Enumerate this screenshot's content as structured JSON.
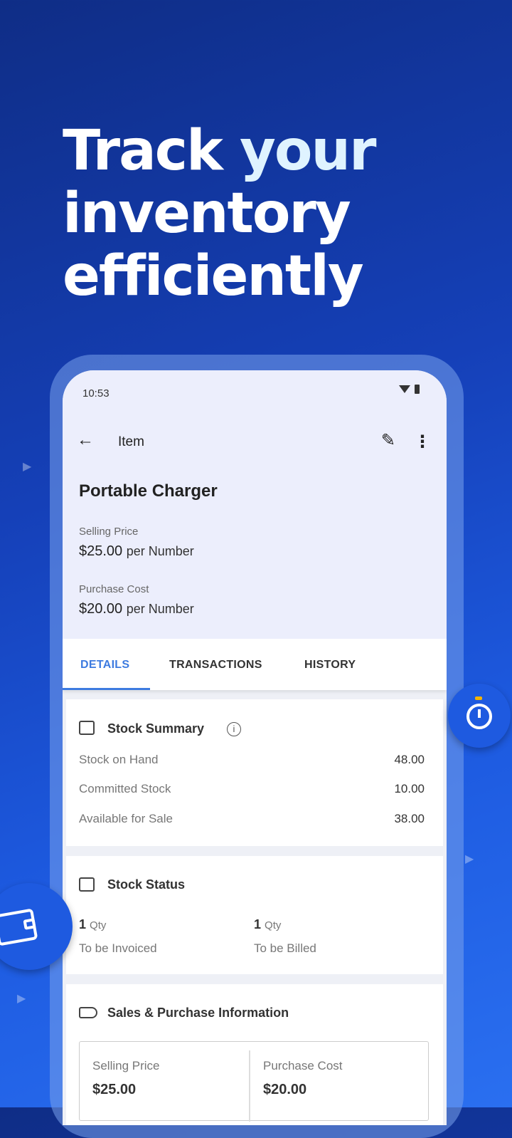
{
  "headline": {
    "line1_a": "Track ",
    "line1_b": "your",
    "line2": "inventory",
    "line3": "efficiently"
  },
  "status_bar": {
    "time": "10:53"
  },
  "app_bar": {
    "title": "Item",
    "back_icon": "arrow-left-icon",
    "edit_icon": "pencil-icon",
    "menu_icon": "more-vertical-icon"
  },
  "item": {
    "name": "Portable Charger",
    "selling_price_label": "Selling Price",
    "selling_price": "$25.00",
    "selling_unit": "per Number",
    "purchase_cost_label": "Purchase Cost",
    "purchase_cost": "$20.00",
    "purchase_unit": "per Number"
  },
  "tabs": [
    {
      "label": "DETAILS",
      "active": true
    },
    {
      "label": "TRANSACTIONS",
      "active": false
    },
    {
      "label": "HISTORY",
      "active": false
    }
  ],
  "stock_summary": {
    "title": "Stock Summary",
    "rows": [
      {
        "label": "Stock on Hand",
        "value": "48.00"
      },
      {
        "label": "Committed Stock",
        "value": "10.00"
      },
      {
        "label": "Available for Sale",
        "value": "38.00"
      }
    ]
  },
  "stock_status": {
    "title": "Stock Status",
    "invoiced_qty": "1",
    "invoiced_unit": "Qty",
    "invoiced_label": "To be Invoiced",
    "billed_qty": "1",
    "billed_unit": "Qty",
    "billed_label": "To be Billed"
  },
  "sales_purchase": {
    "title": "Sales & Purchase Information",
    "selling_label": "Selling Price",
    "selling_value": "$25.00",
    "purchase_label": "Purchase Cost",
    "purchase_value": "$20.00"
  },
  "colors": {
    "accent": "#3d7be0",
    "background": "#1540b8",
    "fab": "#1e5ae0"
  }
}
